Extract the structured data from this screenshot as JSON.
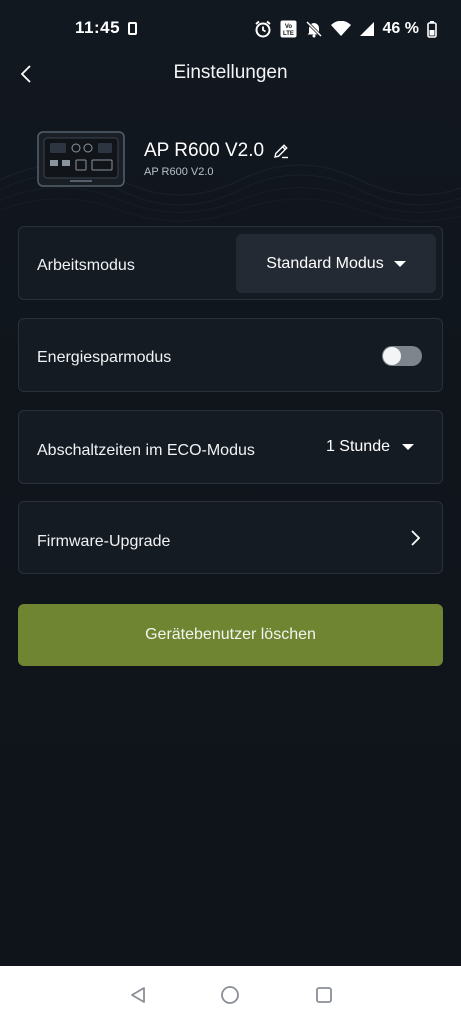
{
  "status_bar": {
    "time": "11:45",
    "battery_percent": "46 %"
  },
  "header": {
    "title": "Einstellungen"
  },
  "device": {
    "name": "AP R600 V2.0",
    "model": "AP R600 V2.0"
  },
  "settings": {
    "work_mode": {
      "label": "Arbeitsmodus",
      "value": "Standard Modus"
    },
    "energy_saving": {
      "label": "Energiesparmodus",
      "enabled": false
    },
    "eco_shutdown": {
      "label": "Abschaltzeiten im ECO-Modus",
      "value": "1 Stunde"
    },
    "firmware": {
      "label": "Firmware-Upgrade"
    }
  },
  "delete_button": {
    "label": "Gerätebenutzer löschen"
  },
  "colors": {
    "background": "#0f131a",
    "card_border": "#2a313b",
    "select_background": "#232a33",
    "accent_green": "#6f8532",
    "toggle_off": "#7f858c"
  },
  "icons": {
    "back": "chevron-left-icon",
    "edit": "pencil-icon",
    "dropdown": "caret-down-icon",
    "firmware": "chevron-right-icon",
    "alarm": "alarm-clock-icon",
    "volte": "volte-icon",
    "mute": "bell-off-icon",
    "wifi": "wifi-icon",
    "signal": "cell-signal-icon",
    "battery": "battery-icon",
    "nav_back": "triangle-back-icon",
    "nav_home": "circle-home-icon",
    "nav_recents": "square-recents-icon"
  }
}
